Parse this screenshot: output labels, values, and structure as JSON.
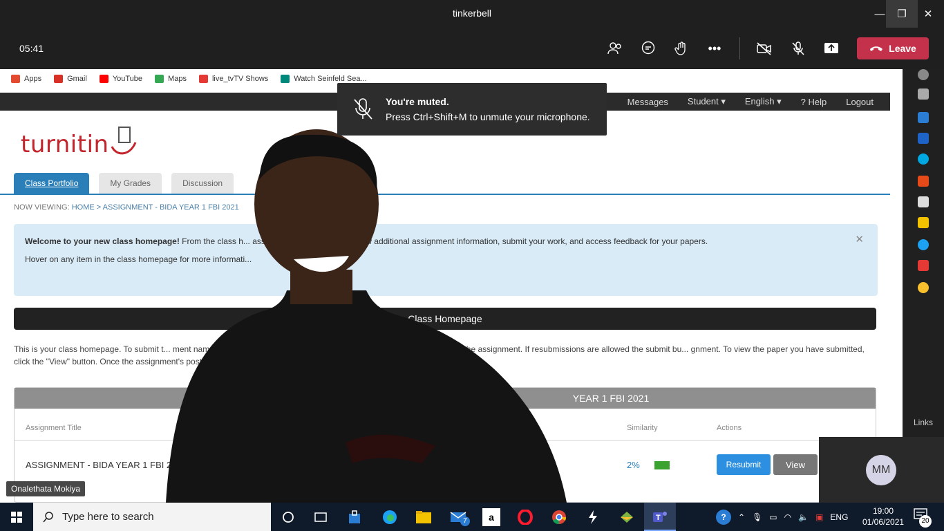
{
  "window": {
    "title": "tinkerbell"
  },
  "call": {
    "timer": "05:41",
    "leave_label": "Leave"
  },
  "toast": {
    "title": "You're muted.",
    "message": "Press Ctrl+Shift+M to unmute your microphone."
  },
  "bookmarks": [
    {
      "label": "Apps",
      "color": "#e34a2f"
    },
    {
      "label": "Gmail",
      "color": "#d93025"
    },
    {
      "label": "YouTube",
      "color": "#ff0000"
    },
    {
      "label": "Maps",
      "color": "#34a853"
    },
    {
      "label": "live_tvTV Shows",
      "color": "#e53935"
    },
    {
      "label": "Watch Seinfeld Sea...",
      "color": "#00897b"
    }
  ],
  "turnitin": {
    "logo": "turnitin",
    "nav": [
      "Messages",
      "Student ▾",
      "English ▾",
      "? Help",
      "Logout"
    ],
    "tabs": [
      "Class Portfolio",
      "My Grades",
      "Discussion"
    ],
    "crumb_label": "NOW VIEWING:",
    "crumb": "HOME > ASSIGNMENT - BIDA YEAR 1 FBI 2021",
    "welcome_bold": "Welcome to your new class homepage!",
    "welcome_text": " From the class h... assignments for your class, view additional assignment information, submit your work, and access feedback for your papers.",
    "welcome_hover": "Hover on any item in the class homepage for more informati...",
    "banner": "Class Homepage",
    "intro": "This is your class homepage. To submit t... ment name. If the Submit button is grayed out, no submissions can be made to the assignment. If resubmissions are allowed the submit bu... gnment. To view the paper you have submitted, click the \"View\" button. Once the assignment's post date has passed, you will also be able t...",
    "table_title": "YEAR 1 FBI 2021",
    "col_title": "Assignment Title",
    "col_similarity": "Similarity",
    "col_actions": "Actions",
    "row_title": "ASSIGNMENT - BIDA YEAR 1 FBI 2",
    "row_similarity": "2%",
    "resubmit_label": "Resubmit",
    "view_label": "View"
  },
  "participant": {
    "name": "Onalethata Mokiya",
    "self_initials": "MM"
  },
  "sidebar": {
    "links_label": "Links"
  },
  "taskbar": {
    "search_placeholder": "Type here to search",
    "mail_badge": "7",
    "lang": "ENG",
    "time": "19:00",
    "date": "01/06/2021",
    "notif_count": "20"
  }
}
